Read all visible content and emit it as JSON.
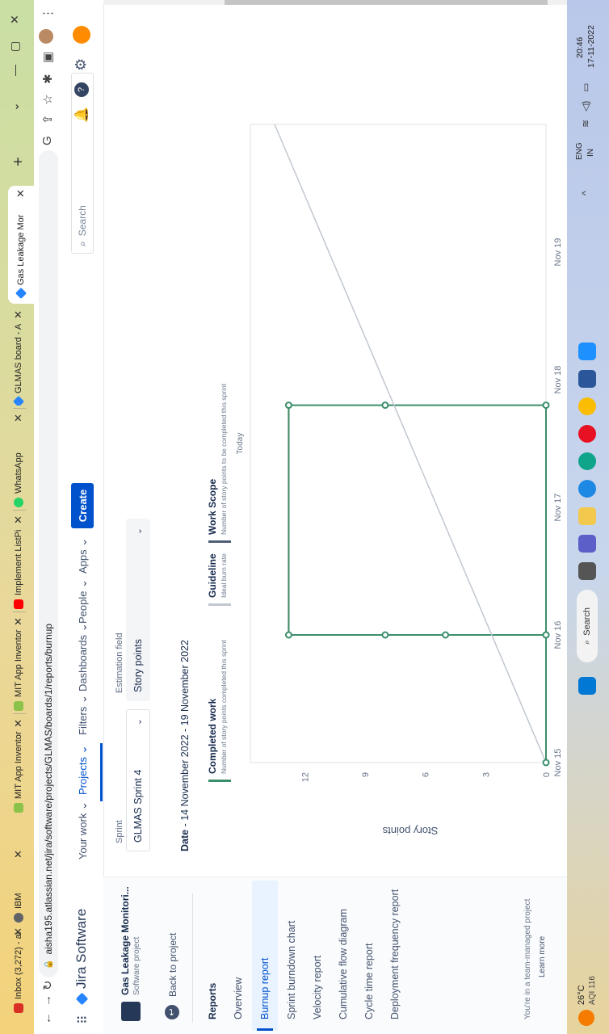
{
  "browser": {
    "tabs": [
      {
        "title": "Inbox (3,272) - ai",
        "color": "#d93025"
      },
      {
        "title": "IBM",
        "color": "#5f6368"
      },
      {
        "title": "MIT App Inventor",
        "color": "#8bc34a"
      },
      {
        "title": "MIT App Inventor",
        "color": "#8bc34a"
      },
      {
        "title": "Implement ListPi",
        "color": "#ff0000"
      },
      {
        "title": "WhatsApp",
        "color": "#25d366"
      },
      {
        "title": "GLMAS board - A",
        "color": "#2684ff"
      },
      {
        "title": "Gas Leakage Mor",
        "color": "#2684ff"
      }
    ],
    "url": "aisha195.atlassian.net/jira/software/projects/GLMAS/boards/1/reports/burnup"
  },
  "jira": {
    "product": "Jira Software",
    "nav": [
      "Your work",
      "Projects",
      "Filters",
      "Dashboards",
      "People",
      "Apps"
    ],
    "create": "Create",
    "search_placeholder": "Search"
  },
  "sidebar": {
    "project_name": "Gas Leakage Monitori...",
    "project_type": "Software project",
    "back": "Back to project",
    "section": "Reports",
    "items": [
      "Overview",
      "Burnup report",
      "Sprint burndown chart",
      "Velocity report",
      "Cumulative flow diagram",
      "Cycle time report",
      "Deployment frequency report"
    ],
    "footer_text": "You're in a team-managed project",
    "footer_link": "Learn more"
  },
  "report": {
    "sprint_label": "Sprint",
    "sprint_value": "GLMAS Sprint 4",
    "estimation_label": "Estimation field",
    "estimation_value": "Story points",
    "date_label": "Date",
    "date_value": " - 14 November 2022 - 19 November 2022",
    "legend": [
      {
        "title": "Completed work",
        "desc": "Number of story points completed this sprint",
        "color": "#3a8f6a"
      },
      {
        "title": "Guideline",
        "desc": "Ideal burn rate",
        "color": "#c1c7d0"
      },
      {
        "title": "Work Scope",
        "desc": "Number of story points to be completed this sprint",
        "color": "#505f79"
      }
    ],
    "today_label": "Today"
  },
  "chart_data": {
    "type": "line",
    "ylabel": "Story points",
    "ylim": [
      0,
      13.5
    ],
    "yticks": [
      0,
      3,
      6,
      9,
      12
    ],
    "xticks": [
      "Nov 15",
      "Nov 16",
      "Nov 17",
      "Nov 18",
      "Nov 19"
    ],
    "xlim": [
      "Nov 15",
      "Nov 20"
    ],
    "series": [
      {
        "name": "Work Scope",
        "color": "#d05a2e",
        "points": [
          [
            "Nov 15",
            0
          ],
          [
            "Nov 16",
            0
          ],
          [
            "Nov 16",
            12.8
          ],
          [
            "Nov 17.8",
            12.8
          ]
        ]
      },
      {
        "name": "Completed work",
        "color": "#3a8f6a",
        "points": [
          [
            "Nov 15",
            0
          ],
          [
            "Nov 16",
            0
          ],
          [
            "Nov 16",
            5
          ],
          [
            "Nov 16",
            8
          ],
          [
            "Nov 16",
            12.8
          ],
          [
            "Nov 17.8",
            12.8
          ],
          [
            "Nov 17.8",
            8
          ],
          [
            "Nov 17.8",
            0
          ],
          [
            "Nov 16",
            0
          ]
        ]
      },
      {
        "name": "Guideline",
        "color": "#c1c7d0",
        "points": [
          [
            "Nov 15",
            0
          ],
          [
            "Nov 20",
            13.5
          ]
        ]
      }
    ]
  },
  "taskbar": {
    "weather_temp": "26°C",
    "weather_aqi": "AQI 116",
    "search": "Search",
    "lang1": "ENG",
    "lang2": "IN",
    "time": "20:46",
    "date": "17-11-2022"
  }
}
